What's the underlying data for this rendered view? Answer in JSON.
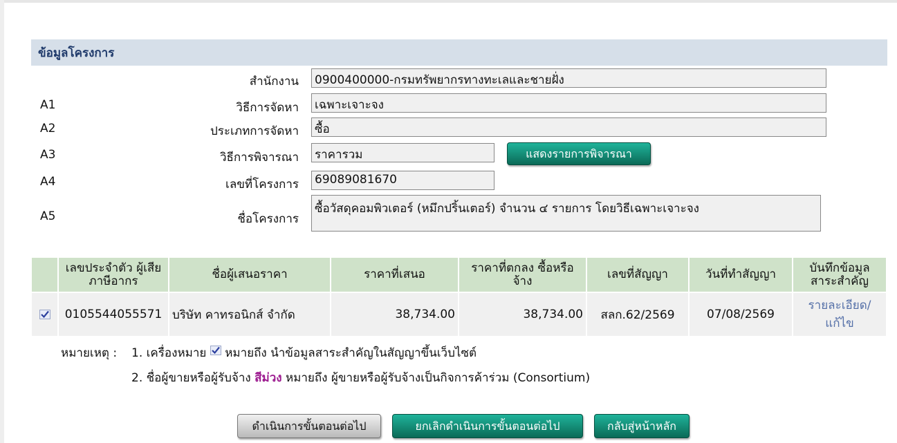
{
  "section": {
    "title": "ข้อมูลโครงการ"
  },
  "form": {
    "office": {
      "label": "สำนักงาน",
      "value": "0900400000-กรมทรัพยากรทางทะเลและชายฝั่ง"
    },
    "a1": {
      "code": "A1",
      "label": "วิธีการจัดหา",
      "value": "เฉพาะเจาะจง"
    },
    "a2": {
      "code": "A2",
      "label": "ประเภทการจัดหา",
      "value": "ซื้อ"
    },
    "a3": {
      "code": "A3",
      "label": "วิธีการพิจารณา",
      "value": "ราคารวม",
      "button": "แสดงรายการพิจารณา"
    },
    "a4": {
      "code": "A4",
      "label": "เลขที่โครงการ",
      "value": "69089081670"
    },
    "a5": {
      "code": "A5",
      "label": "ชื่อโครงการ",
      "value": "ซื้อวัสดุคอมพิวเตอร์ (หมึกปริ้นเตอร์) จำนวน ๔ รายการ โดยวิธีเฉพาะเจาะจง"
    }
  },
  "table": {
    "headers": {
      "tax_id": "เลขประจำตัว ผู้เสียภาษีอากร",
      "bidder": "ชื่อผู้เสนอราคา",
      "offer": "ราคาที่เสนอ",
      "agreed": "ราคาที่ตกลง ซื้อหรือจ้าง",
      "contract_no": "เลขที่สัญญา",
      "contract_date": "วันที่ทำสัญญา",
      "record": "บันทึกข้อมูล สาระสำคัญ"
    },
    "rows": [
      {
        "checked": true,
        "tax_id": "0105544055571",
        "bidder": "บริษัท คาทรอนิกส์ จำกัด",
        "offer": "38,734.00",
        "agreed": "38,734.00",
        "contract_no": "สลก.62/2569",
        "contract_date": "07/08/2569",
        "action": "รายละเอียด/ แก้ไข"
      }
    ]
  },
  "notes": {
    "prefix": "หมายเหตุ :",
    "n1_a": "1. เครื่องหมาย",
    "n1_b": "หมายถึง นำข้อมูลสาระสำคัญในสัญญาขึ้นเว็บไซต์",
    "n2_a": "2. ชื่อผู้ขายหรือผู้รับจ้าง",
    "n2_purple": "สีม่วง",
    "n2_b": "หมายถึง ผู้ขายหรือผู้รับจ้างเป็นกิจการค้าร่วม (Consortium)"
  },
  "colors": {
    "purple": "#9c1a8f",
    "teal": "#0b6a57",
    "header_green": "#cfe2c9"
  },
  "buttons": {
    "proceed": "ดำเนินการขั้นตอนต่อไป",
    "cancel_proceed": "ยกเลิกดำเนินการขั้นตอนต่อไป",
    "home": "กลับสู่หน้าหลัก"
  }
}
